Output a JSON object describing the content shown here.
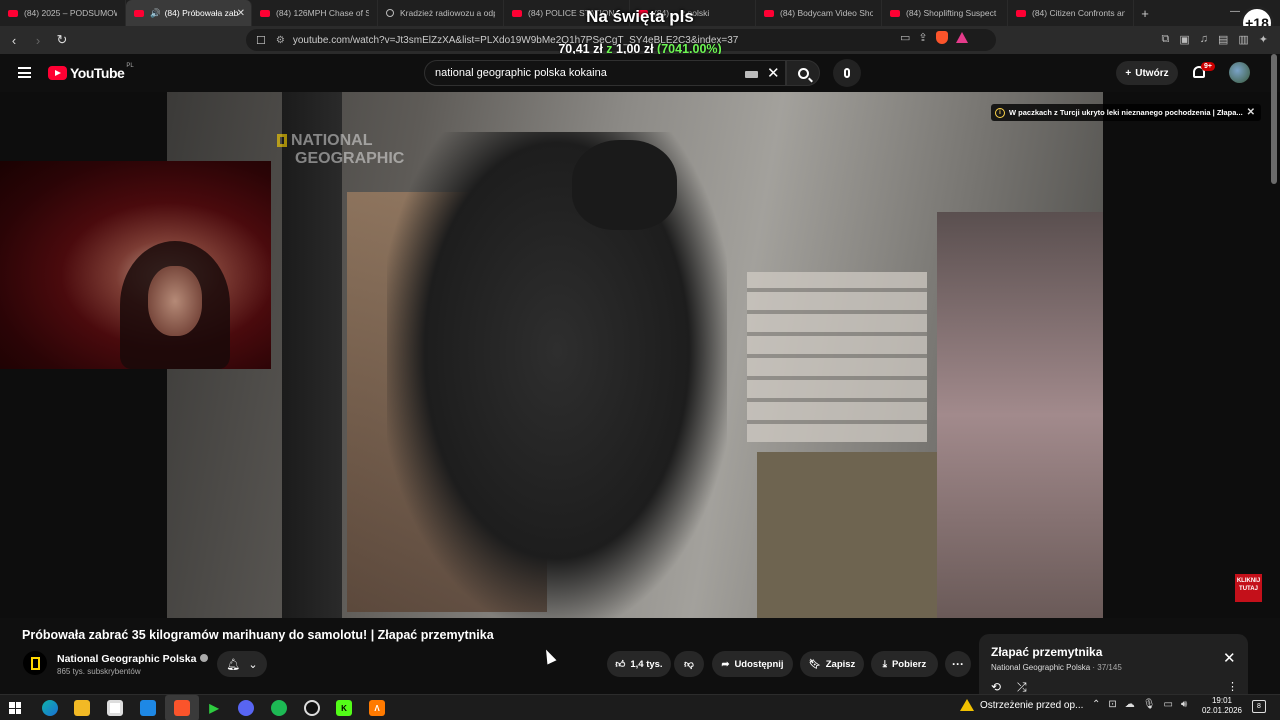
{
  "browser": {
    "tabs": [
      {
        "label": "(84) 2025 – PODSUMOWA",
        "fav": "youtube"
      },
      {
        "label": "(84) Próbowała zab",
        "fav": "youtube",
        "active": true
      },
      {
        "label": "(84) 126MPH Chase of Sto",
        "fav": "youtube"
      },
      {
        "label": "Kradzież radiowozu a odp",
        "fav": "globe"
      },
      {
        "label": "(84) POLICE STATION",
        "fav": "youtube"
      },
      {
        "label": "(84) ... z polski",
        "fav": "youtube"
      },
      {
        "label": "(84) Bodycam Video Show",
        "fav": "youtube"
      },
      {
        "label": "(84) Shoplifting Suspect P",
        "fav": "youtube"
      },
      {
        "label": "(84) Citizen Confronts an",
        "fav": "youtube"
      }
    ],
    "new_tab": "+",
    "url": "youtube.com/watch?v=Jt3smElZzXA&list=PLXdo19W9bMe2Q1h7PSeCgT_SY4eBLE2C3&index=37"
  },
  "overlay": {
    "age_badge": "+18",
    "stream_title": "Na święta pls",
    "donation_amount": "70,41 zł",
    "donation_sep": "z",
    "donation_goal": "1,00 zł",
    "donation_pct": "(7041.00%)"
  },
  "youtube": {
    "logo_text": "YouTube",
    "country": "PL",
    "search_value": "national geographic polska kokaina",
    "create_label": "Utwórz",
    "notif_count": "9+"
  },
  "video": {
    "watermark_line1": "NATIONAL",
    "watermark_line2": "GEOGRAPHIC",
    "info_card": "W paczkach z Turcji ukryto leki nieznanego pochodzenia | Złapa...",
    "subscribe_wm": "KLIKNIJ TUTAJ",
    "title": "Próbowała zabrać 35 kilogramów marihuany do samolotu! | Złapać przemytnika",
    "channel_name": "National Geographic Polska",
    "subscribers": "865 tys. subskrybentów",
    "likes": "1,4 tys.",
    "share": "Udostępnij",
    "save": "Zapisz",
    "download": "Pobierz"
  },
  "playlist": {
    "title": "Złapać przemytnika",
    "channel": "National Geographic Polska",
    "position": "· 37/145"
  },
  "taskbar": {
    "warning": "Ostrzeżenie przed op...",
    "time": "19:01",
    "date": "02.01.2026",
    "notif": "8"
  }
}
